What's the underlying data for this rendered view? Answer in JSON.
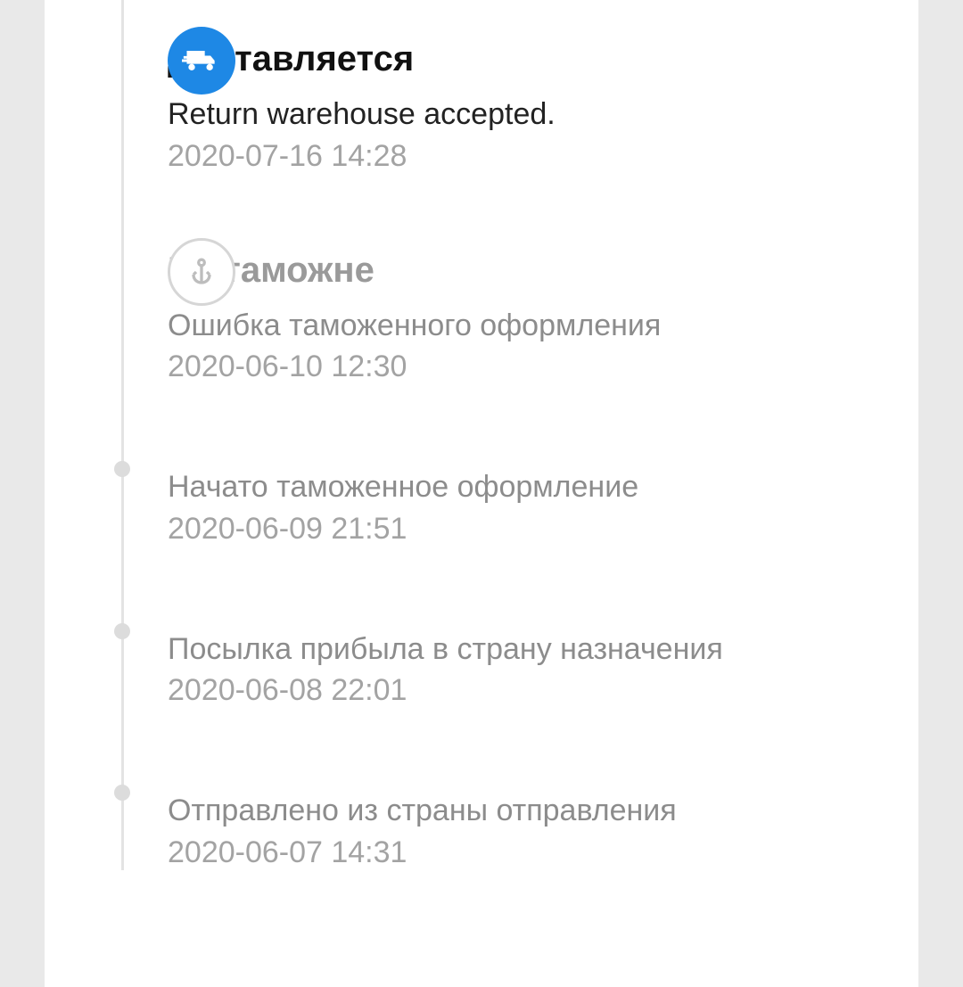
{
  "colors": {
    "accent": "#1e88e5"
  },
  "stage_delivering": {
    "title": "Доставляется",
    "message": "Return warehouse accepted.",
    "timestamp": "2020-07-16 14:28"
  },
  "stage_customs": {
    "title": "На таможне",
    "events": [
      {
        "message": "Ошибка таможенного оформления",
        "timestamp": "2020-06-10 12:30"
      },
      {
        "message": "Начато таможенное оформление",
        "timestamp": "2020-06-09 21:51"
      },
      {
        "message": "Посылка прибыла в страну назначения",
        "timestamp": "2020-06-08 22:01"
      },
      {
        "message": "Отправлено из страны отправления",
        "timestamp": "2020-06-07 14:31"
      }
    ]
  }
}
